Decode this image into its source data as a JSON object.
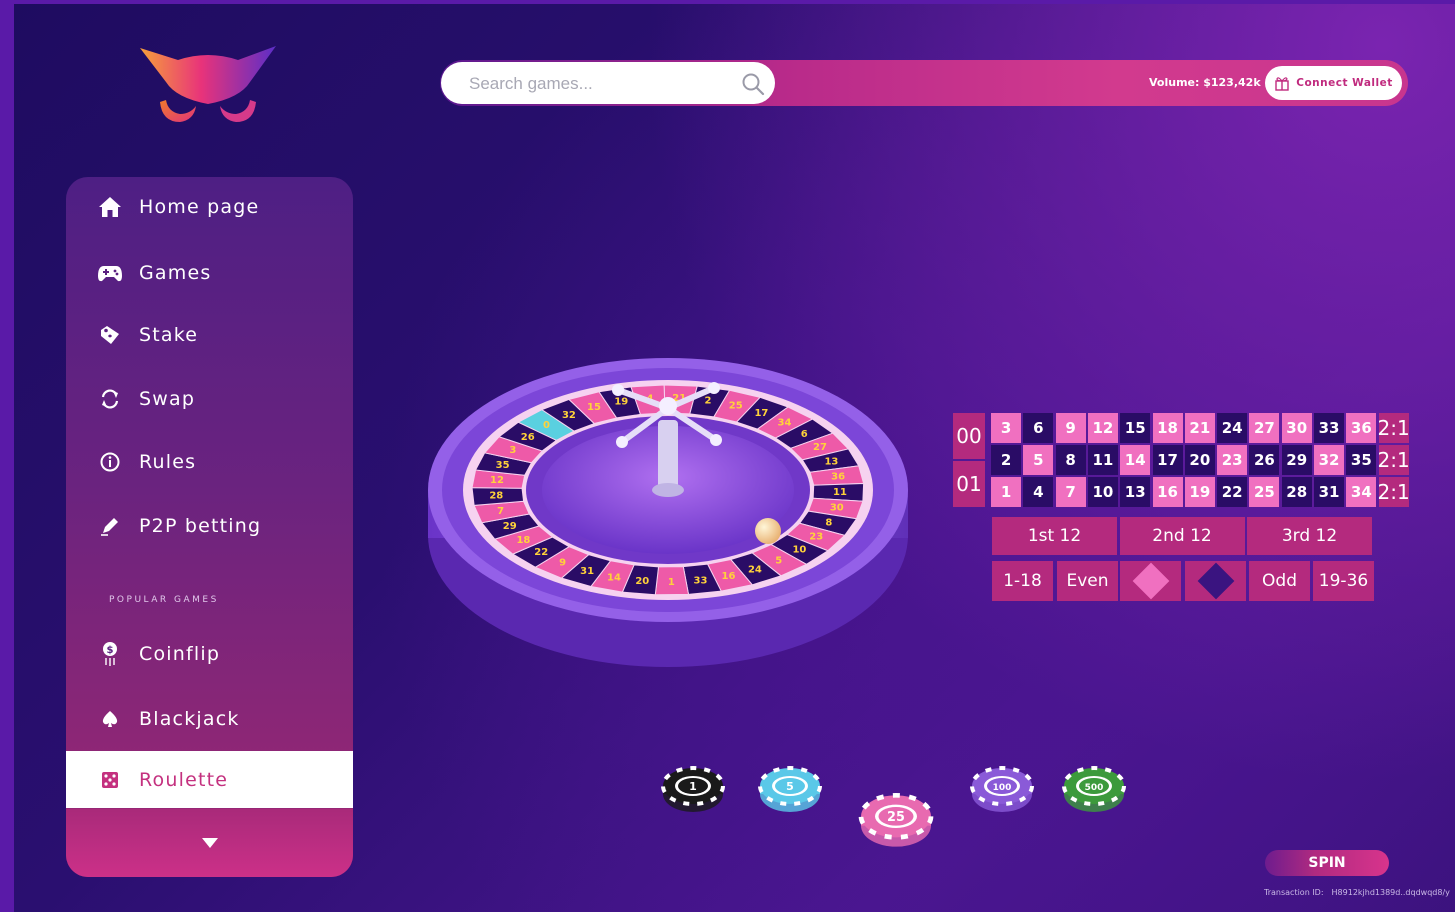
{
  "search": {
    "placeholder": "Search games..."
  },
  "header": {
    "volume": "Volume: $123,42k",
    "connect_wallet": "Connect Wallet"
  },
  "sidebar": {
    "items": [
      {
        "label": "Home page",
        "icon": "home-icon"
      },
      {
        "label": "Games",
        "icon": "gamepad-icon"
      },
      {
        "label": "Stake",
        "icon": "tag-icon"
      },
      {
        "label": "Swap",
        "icon": "refresh-icon"
      },
      {
        "label": "Rules",
        "icon": "info-icon"
      },
      {
        "label": "P2P betting",
        "icon": "pen-icon"
      }
    ],
    "popular_title": "POPULAR GAMES",
    "popular": [
      {
        "label": "Coinflip",
        "icon": "coin-icon"
      },
      {
        "label": "Blackjack",
        "icon": "spade-icon"
      },
      {
        "label": "Roulette",
        "icon": "dice-icon",
        "active": true
      }
    ]
  },
  "board": {
    "zeros": [
      "00",
      "01"
    ],
    "rows": [
      [
        "3",
        "6",
        "9",
        "12",
        "15",
        "18",
        "21",
        "24",
        "27",
        "30",
        "33",
        "36"
      ],
      [
        "2",
        "5",
        "8",
        "11",
        "14",
        "17",
        "20",
        "23",
        "26",
        "29",
        "32",
        "35"
      ],
      [
        "1",
        "4",
        "7",
        "10",
        "13",
        "16",
        "19",
        "22",
        "25",
        "28",
        "31",
        "34"
      ]
    ],
    "pink_numbers": [
      "3",
      "9",
      "12",
      "18",
      "21",
      "27",
      "30",
      "36",
      "5",
      "14",
      "23",
      "32",
      "1",
      "7",
      "16",
      "19",
      "25",
      "34"
    ],
    "ratio": "2:1",
    "dozens": [
      "1st 12",
      "2nd 12",
      "3rd 12"
    ],
    "outside": [
      "1-18",
      "Even",
      "Odd",
      "19-36"
    ]
  },
  "wheel": {
    "numbers": [
      "21",
      "2",
      "25",
      "17",
      "34",
      "6",
      "27",
      "13",
      "36",
      "11",
      "30",
      "8",
      "23",
      "10",
      "5",
      "24",
      "16",
      "33",
      "1",
      "20",
      "14",
      "31",
      "9",
      "22",
      "18",
      "29",
      "7",
      "28",
      "12",
      "35",
      "3",
      "26",
      "0",
      "32",
      "15",
      "19",
      "4"
    ]
  },
  "chips": [
    {
      "value": "1",
      "color": "#1a1a1a"
    },
    {
      "value": "5",
      "color": "#5ac8e8"
    },
    {
      "value": "25",
      "color": "#e86ab0"
    },
    {
      "value": "100",
      "color": "#8a5ad8"
    },
    {
      "value": "500",
      "color": "#3c9a3c"
    }
  ],
  "spin_label": "SPIN",
  "transaction": {
    "label": "Transaction ID:",
    "value": "H8912kjhd1389d..dqdwqd8/y"
  },
  "colors": {
    "accent": "#c4317f",
    "pink": "#f070c0",
    "dark": "#2a0c66"
  }
}
